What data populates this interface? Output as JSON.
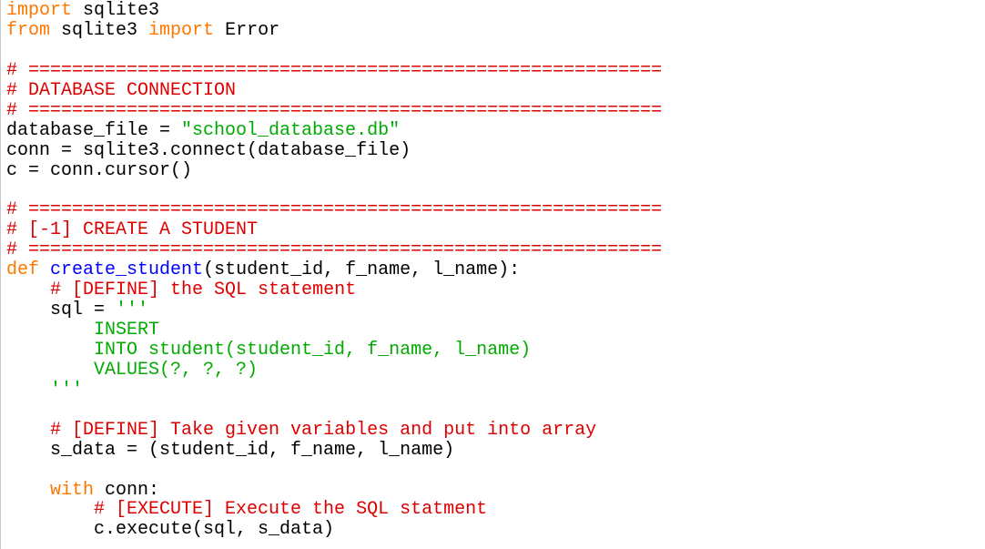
{
  "editor": {
    "colors": {
      "keyword": "#ff7700",
      "comment": "#dd0000",
      "string": "#00aa00",
      "definition": "#0000ff",
      "text": "#000000",
      "background": "#ffffff"
    },
    "lines": [
      [
        {
          "t": "import",
          "c": "kw"
        },
        {
          "t": " sqlite3",
          "c": "pl"
        }
      ],
      [
        {
          "t": "from",
          "c": "kw"
        },
        {
          "t": " sqlite3 ",
          "c": "pl"
        },
        {
          "t": "import",
          "c": "kw"
        },
        {
          "t": " Error",
          "c": "pl"
        }
      ],
      [],
      [
        {
          "t": "# ==========================================================",
          "c": "cm"
        }
      ],
      [
        {
          "t": "# DATABASE CONNECTION",
          "c": "cm"
        }
      ],
      [
        {
          "t": "# ==========================================================",
          "c": "cm"
        }
      ],
      [
        {
          "t": "database_file = ",
          "c": "pl"
        },
        {
          "t": "\"school_database.db\"",
          "c": "st"
        }
      ],
      [
        {
          "t": "conn = sqlite3.connect(database_file)",
          "c": "pl"
        }
      ],
      [
        {
          "t": "c = conn.cursor()",
          "c": "pl"
        }
      ],
      [],
      [
        {
          "t": "# ==========================================================",
          "c": "cm"
        }
      ],
      [
        {
          "t": "# [-1] CREATE A STUDENT",
          "c": "cm"
        }
      ],
      [
        {
          "t": "# ==========================================================",
          "c": "cm"
        }
      ],
      [
        {
          "t": "def",
          "c": "kw"
        },
        {
          "t": " ",
          "c": "pl"
        },
        {
          "t": "create_student",
          "c": "df"
        },
        {
          "t": "(student_id, f_name, l_name):",
          "c": "pl"
        }
      ],
      [
        {
          "t": "    ",
          "c": "pl"
        },
        {
          "t": "# [DEFINE] the SQL statement",
          "c": "cm"
        }
      ],
      [
        {
          "t": "    sql = ",
          "c": "pl"
        },
        {
          "t": "'''",
          "c": "st"
        }
      ],
      [
        {
          "t": "        INSERT",
          "c": "st"
        }
      ],
      [
        {
          "t": "        INTO student(student_id, f_name, l_name)",
          "c": "st"
        }
      ],
      [
        {
          "t": "        VALUES(?, ?, ?)",
          "c": "st"
        }
      ],
      [
        {
          "t": "    '''",
          "c": "st"
        }
      ],
      [],
      [
        {
          "t": "    ",
          "c": "pl"
        },
        {
          "t": "# [DEFINE] Take given variables and put into array",
          "c": "cm"
        }
      ],
      [
        {
          "t": "    s_data = (student_id, f_name, l_name)",
          "c": "pl"
        }
      ],
      [],
      [
        {
          "t": "    ",
          "c": "pl"
        },
        {
          "t": "with",
          "c": "kw"
        },
        {
          "t": " conn:",
          "c": "pl"
        }
      ],
      [
        {
          "t": "        ",
          "c": "pl"
        },
        {
          "t": "# [EXECUTE] Execute the SQL statment",
          "c": "cm"
        }
      ],
      [
        {
          "t": "        c.execute(sql, s_data)",
          "c": "pl"
        }
      ]
    ]
  }
}
